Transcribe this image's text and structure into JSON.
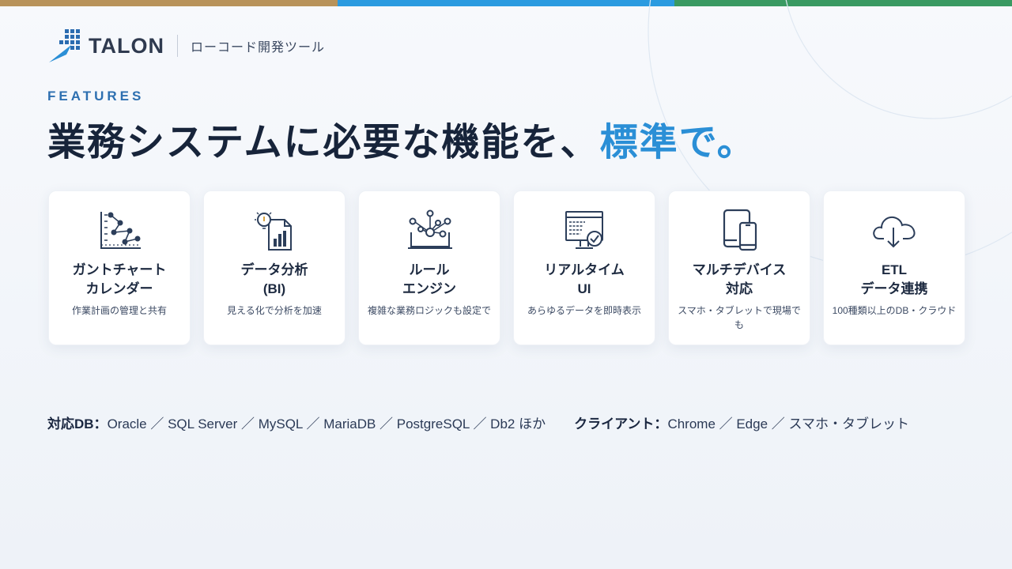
{
  "colors": {
    "bar_gold": "#b8935a",
    "bar_blue": "#2b9be0",
    "bar_green": "#3a9a62",
    "accent": "#2b8fd6",
    "navy": "#17243a"
  },
  "brand": {
    "name": "TALON",
    "tagline": "ローコード開発ツール"
  },
  "eyebrow": "FEATURES",
  "headline": {
    "main": "業務システムに必要な機能を、",
    "accent": "標準で。"
  },
  "features": [
    {
      "icon": "gantt-chart-icon",
      "title1": "ガントチャート",
      "title2": "カレンダー",
      "desc": "作業計画の管理と共有"
    },
    {
      "icon": "bi-analytics-icon",
      "title1": "データ分析",
      "title2": "(BI)",
      "desc": "見える化で分析を加速"
    },
    {
      "icon": "rule-engine-icon",
      "title1": "ルール",
      "title2": "エンジン",
      "desc": "複雑な業務ロジックも設定で"
    },
    {
      "icon": "realtime-ui-icon",
      "title1": "リアルタイム",
      "title2": "UI",
      "desc": "あらゆるデータを即時表示"
    },
    {
      "icon": "multi-device-icon",
      "title1": "マルチデバイス",
      "title2": "対応",
      "desc": "スマホ・タブレットで現場でも"
    },
    {
      "icon": "cloud-download-icon",
      "title1": "ETL",
      "title2": "データ連携",
      "desc": "100種類以上のDB・クラウド"
    }
  ],
  "footer": {
    "db_label": "対応DB：",
    "db_values": "Oracle ／ SQL Server ／ MySQL ／ MariaDB ／ PostgreSQL ／ Db2 ほか",
    "client_label": "クライアント：",
    "client_values": "Chrome ／ Edge ／ スマホ・タブレット"
  }
}
